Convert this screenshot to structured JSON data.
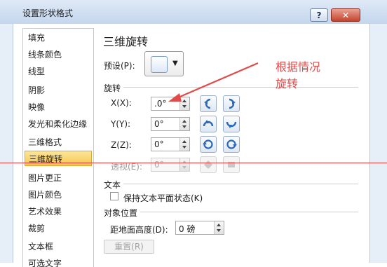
{
  "window": {
    "title": "设置形状格式",
    "help_label": "?",
    "close_label": "✕"
  },
  "sidebar": {
    "items": [
      {
        "label": "填充",
        "selected": false
      },
      {
        "label": "线条颜色",
        "selected": false
      },
      {
        "label": "线型",
        "selected": false
      },
      {
        "label": "阴影",
        "selected": false
      },
      {
        "label": "映像",
        "selected": false
      },
      {
        "label": "发光和柔化边缘",
        "selected": false
      },
      {
        "label": "三维格式",
        "selected": false
      },
      {
        "label": "三维旋转",
        "selected": true
      },
      {
        "label": "图片更正",
        "selected": false
      },
      {
        "label": "图片颜色",
        "selected": false
      },
      {
        "label": "艺术效果",
        "selected": false
      },
      {
        "label": "裁剪",
        "selected": false
      },
      {
        "label": "文本框",
        "selected": false
      },
      {
        "label": "可选文字",
        "selected": false
      }
    ]
  },
  "pane": {
    "title": "三维旋转",
    "preset_label": "预设(P):",
    "rotation_section": "旋转",
    "x": {
      "label": "X(X):",
      "value": ".0°"
    },
    "y": {
      "label": "Y(Y):",
      "value": "0°"
    },
    "z": {
      "label": "Z(Z):",
      "value": "0°"
    },
    "perspective": {
      "label": "透视(E):",
      "value": "0°"
    },
    "text_section": "文本",
    "keep_text_flat": "保持文本平面状态(K)",
    "object_position_section": "对象位置",
    "distance_label": "距地面高度(D):",
    "distance_value": "0 磅",
    "reset_label": "重置(R)"
  },
  "annotation": {
    "line1": "根据情况",
    "line2": "旋转",
    "color": "#e24a4a"
  },
  "icons": [
    "left-rotate-icon",
    "right-rotate-icon",
    "up-rotate-icon",
    "down-rotate-icon",
    "counterclockwise-icon",
    "clockwise-icon",
    "narrow-perspective-icon",
    "widen-perspective-icon"
  ]
}
